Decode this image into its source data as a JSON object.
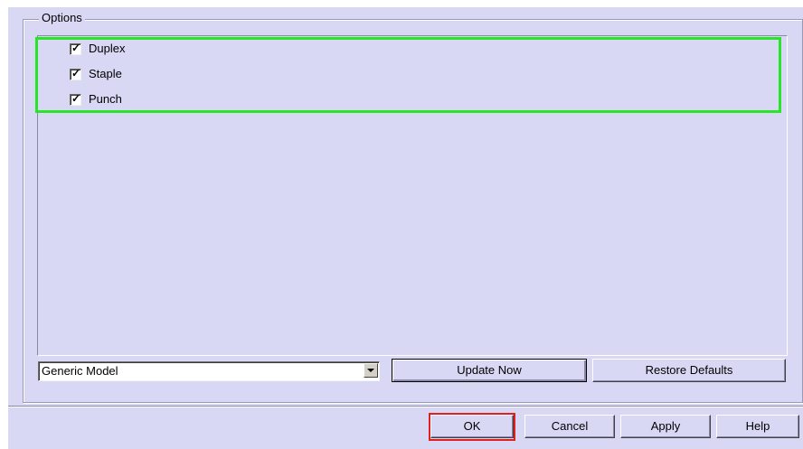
{
  "group": {
    "title": "Options"
  },
  "options": [
    {
      "label": "Duplex",
      "checked": true
    },
    {
      "label": "Staple",
      "checked": true
    },
    {
      "label": "Punch",
      "checked": true
    }
  ],
  "model_select": {
    "value": "Generic Model"
  },
  "buttons": {
    "update_now": "Update Now",
    "restore_defaults": "Restore Defaults",
    "ok": "OK",
    "cancel": "Cancel",
    "apply": "Apply",
    "help": "Help"
  },
  "colors": {
    "dialog_bg": "#d8d8f4",
    "highlight_green": "#27e627",
    "highlight_red": "#e02020"
  }
}
